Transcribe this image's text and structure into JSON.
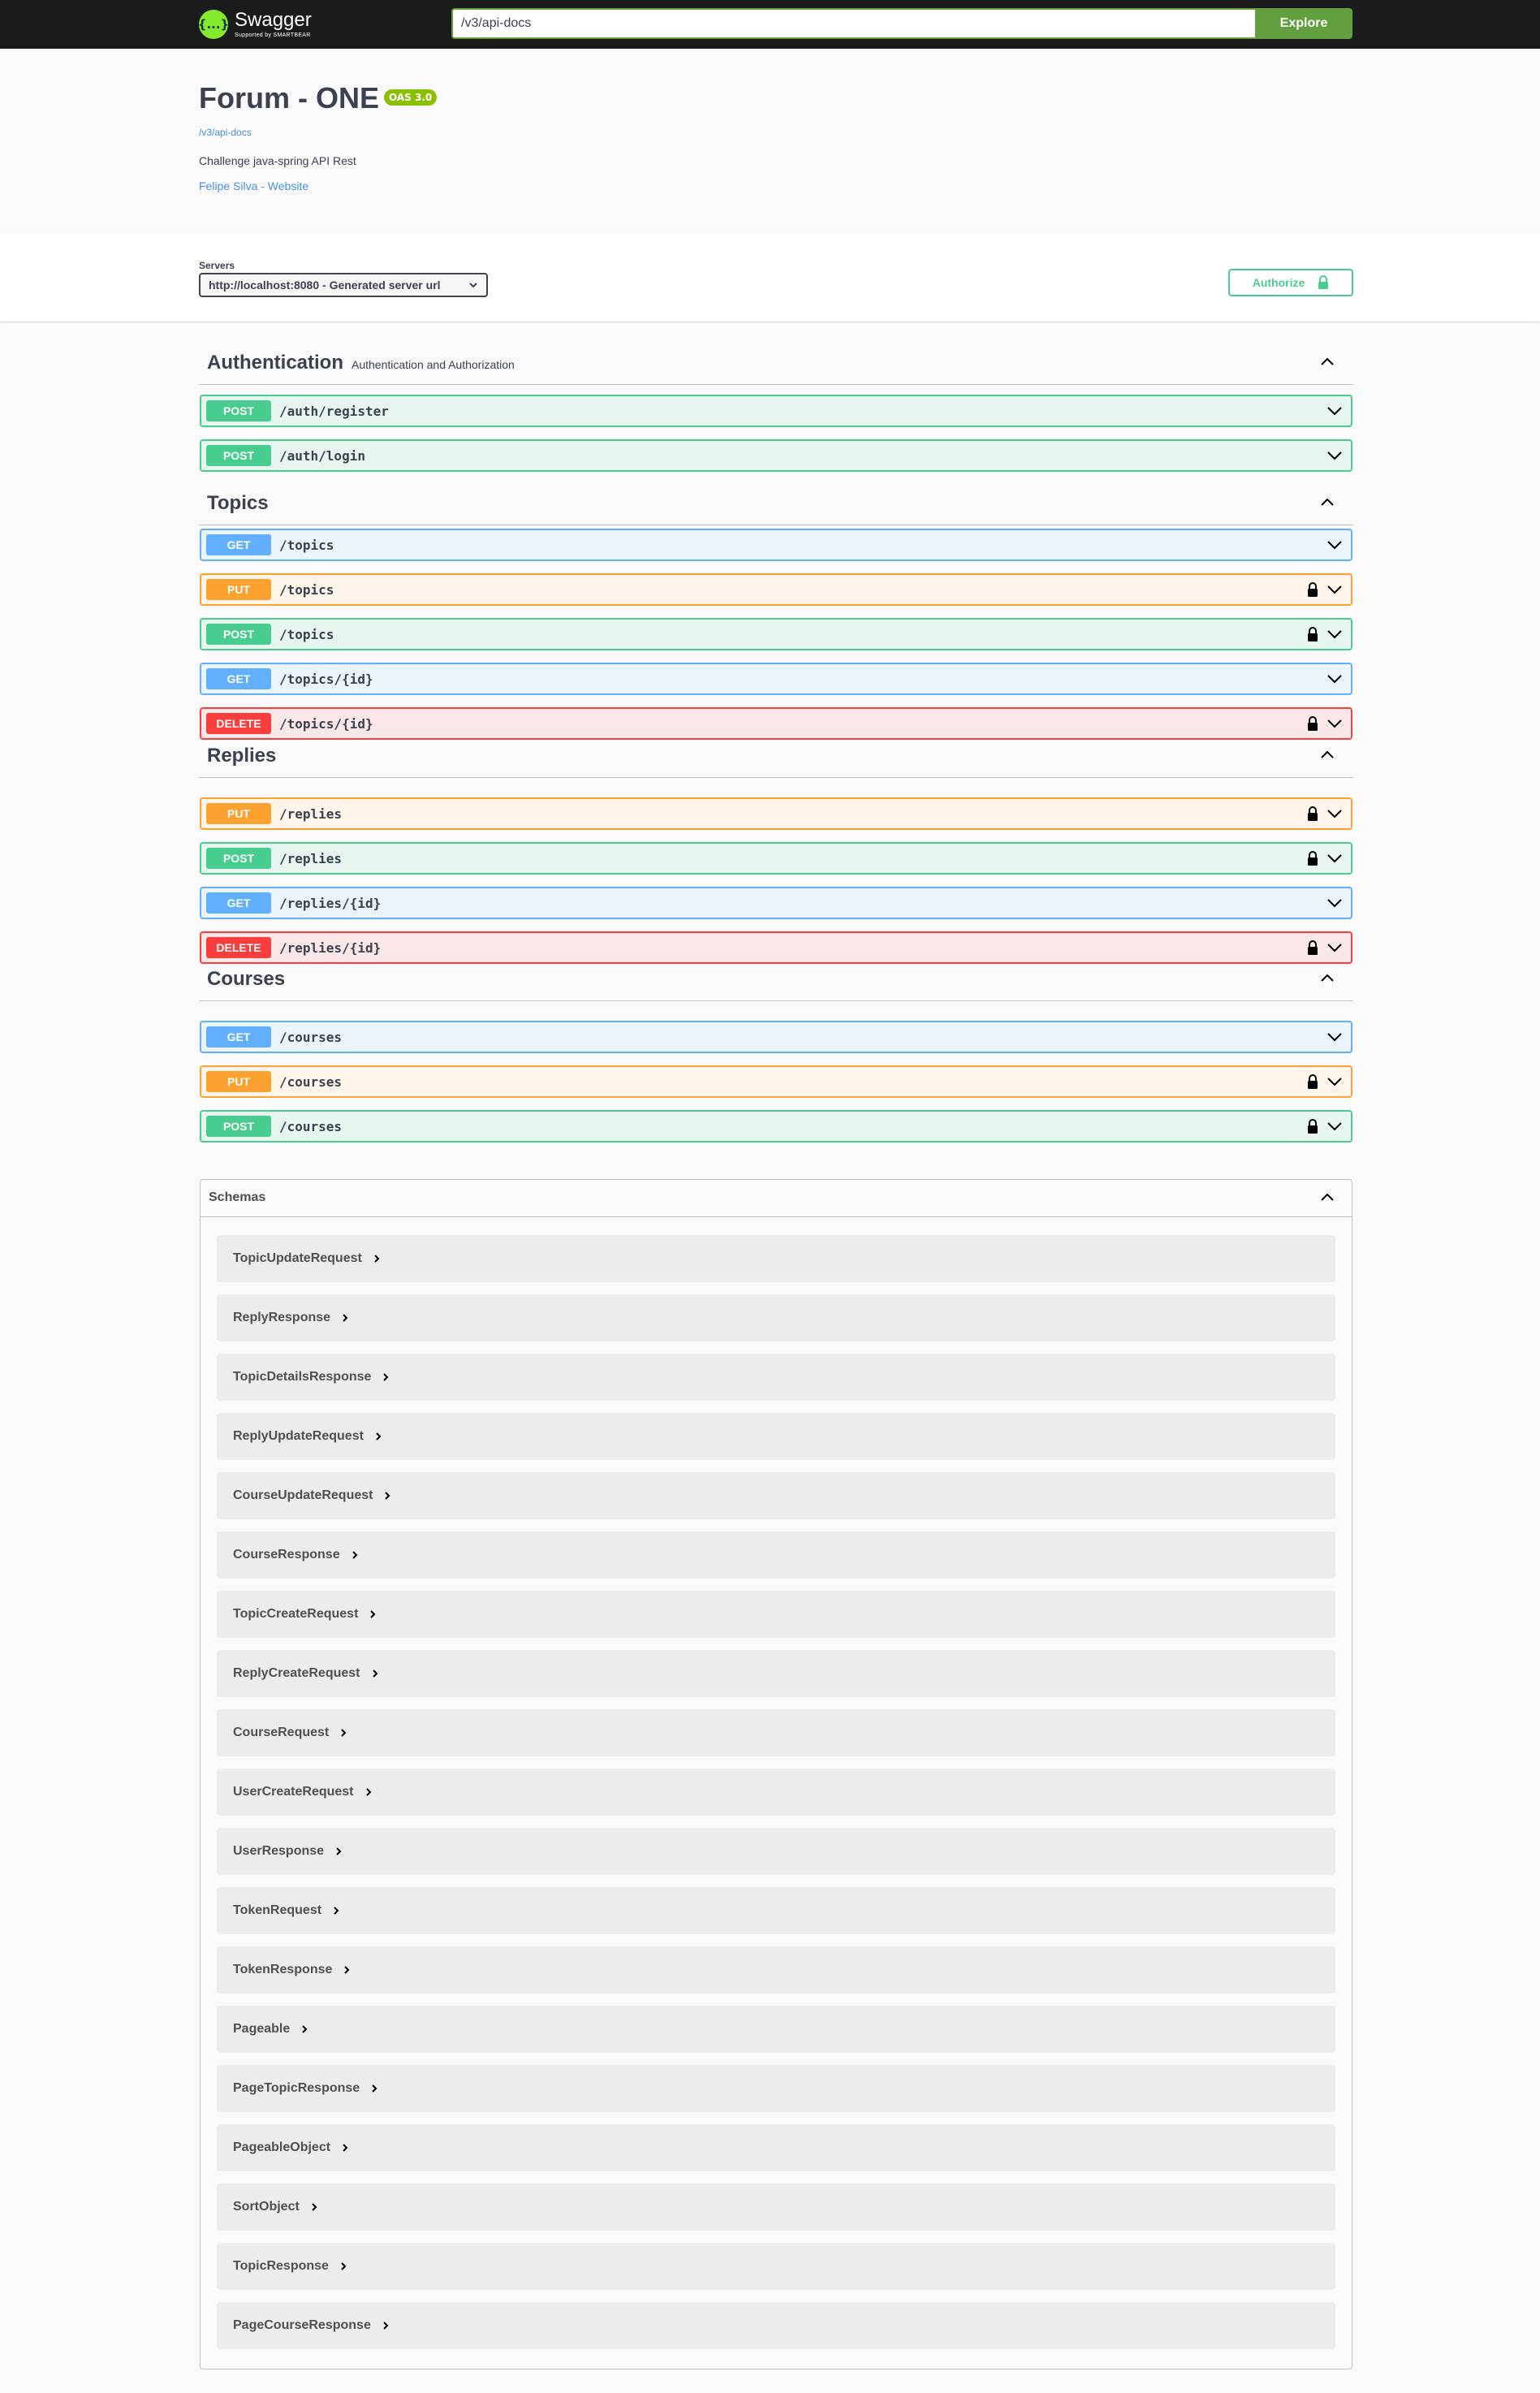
{
  "topbar": {
    "brand": "Swagger",
    "brand_sub": "Supported by SMARTBEAR",
    "logo_glyph": "{...}",
    "url_value": "/v3/api-docs",
    "explore_label": "Explore"
  },
  "info": {
    "title": "Forum - ONE",
    "version_badge": "OAS 3.0",
    "spec_url": "/v3/api-docs",
    "description": "Challenge java-spring API Rest",
    "contact": "Felipe Silva - Website"
  },
  "servers": {
    "label": "Servers",
    "selected": "http://localhost:8080 - Generated server url",
    "authorize_label": "Authorize"
  },
  "tags": [
    {
      "name": "Authentication",
      "description": "Authentication and Authorization",
      "ops": [
        {
          "method": "POST",
          "path": "/auth/register",
          "locked": false
        },
        {
          "method": "POST",
          "path": "/auth/login",
          "locked": false
        }
      ]
    },
    {
      "name": "Topics",
      "description": "",
      "ops": [
        {
          "method": "GET",
          "path": "/topics",
          "locked": false
        },
        {
          "method": "PUT",
          "path": "/topics",
          "locked": true
        },
        {
          "method": "POST",
          "path": "/topics",
          "locked": true
        },
        {
          "method": "GET",
          "path": "/topics/{id}",
          "locked": false
        },
        {
          "method": "DELETE",
          "path": "/topics/{id}",
          "locked": true
        }
      ]
    },
    {
      "name": "Replies",
      "description": "",
      "ops": [
        {
          "method": "PUT",
          "path": "/replies",
          "locked": true
        },
        {
          "method": "POST",
          "path": "/replies",
          "locked": true
        },
        {
          "method": "GET",
          "path": "/replies/{id}",
          "locked": false
        },
        {
          "method": "DELETE",
          "path": "/replies/{id}",
          "locked": true
        }
      ]
    },
    {
      "name": "Courses",
      "description": "",
      "ops": [
        {
          "method": "GET",
          "path": "/courses",
          "locked": false
        },
        {
          "method": "PUT",
          "path": "/courses",
          "locked": true
        },
        {
          "method": "POST",
          "path": "/courses",
          "locked": true
        }
      ]
    }
  ],
  "schemas": {
    "title": "Schemas",
    "items": [
      "TopicUpdateRequest",
      "ReplyResponse",
      "TopicDetailsResponse",
      "ReplyUpdateRequest",
      "CourseUpdateRequest",
      "CourseResponse",
      "TopicCreateRequest",
      "ReplyCreateRequest",
      "CourseRequest",
      "UserCreateRequest",
      "UserResponse",
      "TokenRequest",
      "TokenResponse",
      "Pageable",
      "PageTopicResponse",
      "PageableObject",
      "SortObject",
      "TopicResponse",
      "PageCourseResponse"
    ]
  },
  "colors": {
    "post": "#49cc90",
    "get": "#61affe",
    "put": "#fca130",
    "delete": "#f93e3e",
    "topbar": "#1b1b1b",
    "explore": "#62a03f",
    "badge": "#89bf04"
  },
  "icons": {
    "lock": "lock-icon",
    "expand": "chevron-down-icon",
    "collapse": "chevron-up-icon",
    "model_expand": "chevron-right-icon",
    "select": "chevron-down-icon"
  }
}
